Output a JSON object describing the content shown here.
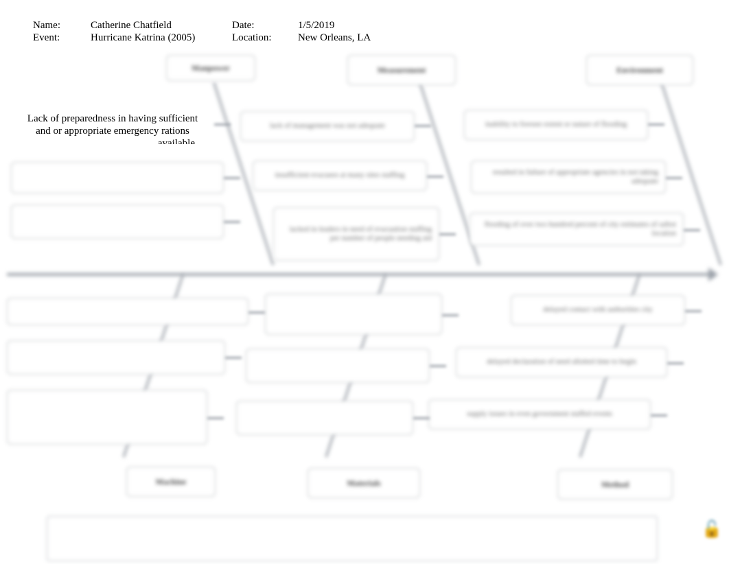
{
  "header": {
    "name_label": "Name:",
    "name_value": "Catherine Chatfield",
    "date_label": "Date:",
    "date_value": "1/5/2019",
    "event_label": "Event:",
    "event_value": "Hurricane Katrina (2005)",
    "location_label": "Location:",
    "location_value": "New Orleans, LA"
  },
  "categories_top": [
    "Manpower",
    "Measure­ment",
    "Environ­ment"
  ],
  "categories_bottom": [
    "Machine",
    "Materials",
    "Method"
  ],
  "sharp_cause": {
    "line1": "Lack of preparedness in having sufficient",
    "line2": "and or appropriate emergency rations",
    "trail": "available"
  },
  "blurred_causes": {
    "top_mid_1": "lack of management was not adequate",
    "top_mid_2": "insufficient evacuees at many sites staffing",
    "top_mid_3": "lacked in leaders in need of evacuation staffing per number of people needing aid",
    "top_right_1": "inability to foresee extent or nature of flooding",
    "top_right_2": "resulted in failure of appropriate agencies in not taking adequate",
    "top_right_3": "flooding of over two hundred percent of city estimates of safest location",
    "bot_right_1": "delayed contact with authorities city",
    "bot_right_2": "delayed declaration of need allotted time to begin",
    "bot_right_3": "supply issues in even government staffed events"
  }
}
